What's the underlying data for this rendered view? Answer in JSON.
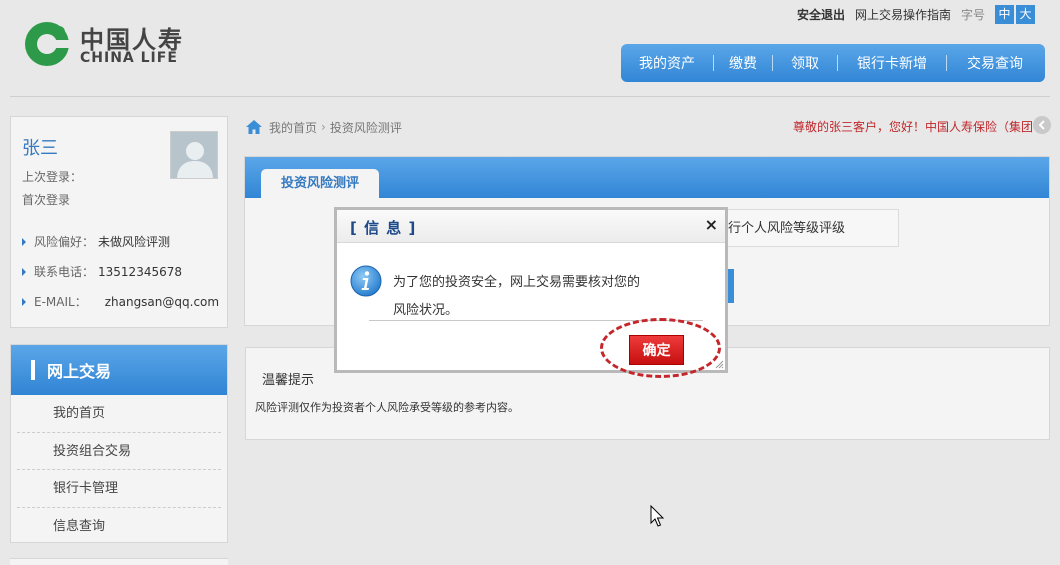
{
  "brand": {
    "name_cn": "中国人寿",
    "name_en": "CHINA LIFE",
    "color": "#2d9a4a"
  },
  "top_links": {
    "logout": "安全退出",
    "guide": "网上交易操作指南",
    "font_size_label": "字号",
    "font_medium": "中",
    "font_large": "大"
  },
  "main_nav": [
    "我的资产",
    "缴费",
    "领取",
    "银行卡新增",
    "交易查询"
  ],
  "user": {
    "name": "张三",
    "last_login_label": "上次登录：",
    "first_login": "首次登录",
    "risk_label": "风险偏好：",
    "risk_value": "未做风险评测",
    "phone_label": "联系电话：",
    "phone_value": "13512345678",
    "email_label": "E-MAIL：",
    "email_value": "zhangsan@qq.com"
  },
  "menu": {
    "title": "网上交易",
    "items": [
      "我的首页",
      "投资组合交易",
      "银行卡管理",
      "信息查询"
    ]
  },
  "breadcrumb": {
    "home": "我的首页",
    "separator": "›",
    "current": "投资风险测评"
  },
  "welcome_text": "尊敬的张三客户，您好！中国人寿保险（集团",
  "risk_panel": {
    "tab": "投资风险测评",
    "box_text": "行个人风险等级评级"
  },
  "tips": {
    "title": "温馨提示",
    "text": "风险评测仅作为投资者个人风险承受等级的参考内容。"
  },
  "modal": {
    "title": "[ 信 息 ]",
    "close": "×",
    "message_line1": "为了您的投资安全，网上交易需要核对您的",
    "message_line2": "风险状况。",
    "ok": "确定"
  },
  "colors": {
    "accent": "#3a8ed8",
    "danger": "#c4262a",
    "welcome": "#c0282d"
  }
}
